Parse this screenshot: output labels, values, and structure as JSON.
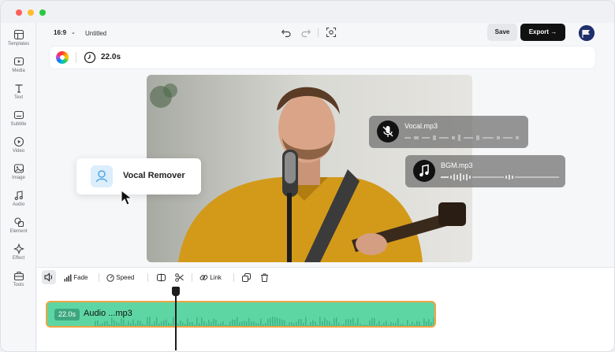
{
  "window": {
    "traffic_lights": [
      "close",
      "minimize",
      "maximize"
    ]
  },
  "sidebar": {
    "items": [
      {
        "label": "Templates",
        "icon": "templates-icon"
      },
      {
        "label": "Media",
        "icon": "media-icon"
      },
      {
        "label": "Text",
        "icon": "text-icon"
      },
      {
        "label": "Subtitle",
        "icon": "subtitle-icon"
      },
      {
        "label": "Video",
        "icon": "video-icon"
      },
      {
        "label": "Image",
        "icon": "image-icon"
      },
      {
        "label": "Audio",
        "icon": "audio-icon"
      },
      {
        "label": "Element",
        "icon": "element-icon"
      },
      {
        "label": "Effect",
        "icon": "effect-icon"
      },
      {
        "label": "Tools",
        "icon": "tools-icon"
      }
    ]
  },
  "header": {
    "aspect_ratio": "16:9",
    "project_title": "Untitled",
    "save_label": "Save",
    "export_label": "Export"
  },
  "properties": {
    "duration": "22.0s"
  },
  "overlay": {
    "vocal_remover_label": "Vocal Remover",
    "tracks": [
      {
        "name": "Vocal.mp3",
        "icon": "mic-off-icon"
      },
      {
        "name": "BGM.mp3",
        "icon": "music-note-icon"
      }
    ]
  },
  "timeline": {
    "tools": {
      "fade": "Fade",
      "speed": "Speed",
      "link": "Link"
    },
    "clip": {
      "duration": "22.0s",
      "name": "Audio ...mp3"
    }
  },
  "colors": {
    "accent_dark": "#111111",
    "clip_fill": "#5ed6a4",
    "clip_border": "#f2a341"
  }
}
